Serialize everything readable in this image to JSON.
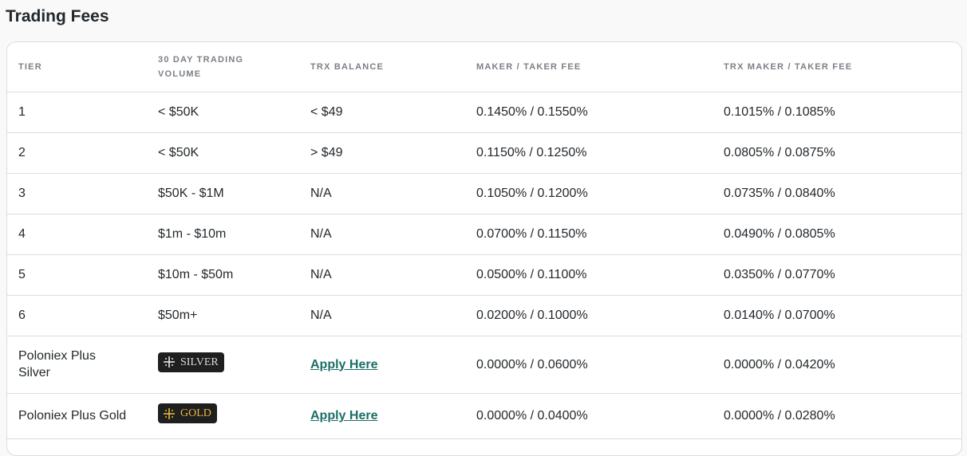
{
  "page": {
    "title": "Trading Fees"
  },
  "table": {
    "headers": [
      "TIER",
      "30 DAY TRADING VOLUME",
      "TRX BALANCE",
      "MAKER / TAKER FEE",
      "TRX MAKER / TAKER FEE"
    ],
    "rows": [
      {
        "tier": "1",
        "volume": "< $50K",
        "trx_balance": "< $49",
        "maker_taker": "0.1450% / 0.1550%",
        "trx_maker_taker": "0.1015% / 0.1085%"
      },
      {
        "tier": "2",
        "volume": "< $50K",
        "trx_balance": "> $49",
        "maker_taker": "0.1150% / 0.1250%",
        "trx_maker_taker": "0.0805% / 0.0875%"
      },
      {
        "tier": "3",
        "volume": "$50K - $1M",
        "trx_balance": "N/A",
        "maker_taker": "0.1050% / 0.1200%",
        "trx_maker_taker": "0.0735% / 0.0840%"
      },
      {
        "tier": "4",
        "volume": "$1m - $10m",
        "trx_balance": "N/A",
        "maker_taker": "0.0700% / 0.1150%",
        "trx_maker_taker": "0.0490% / 0.0805%"
      },
      {
        "tier": "5",
        "volume": "$10m - $50m",
        "trx_balance": "N/A",
        "maker_taker": "0.0500% / 0.1100%",
        "trx_maker_taker": "0.0350% / 0.0770%"
      },
      {
        "tier": "6",
        "volume": "$50m+",
        "trx_balance": "N/A",
        "maker_taker": "0.0200% / 0.1000%",
        "trx_maker_taker": "0.0140% / 0.0700%"
      },
      {
        "tier": "Poloniex Plus Silver",
        "badge": "SILVER",
        "trx_balance_link": "Apply Here",
        "maker_taker": "0.0000% / 0.0600%",
        "trx_maker_taker": "0.0000% / 0.0420%"
      },
      {
        "tier": "Poloniex Plus Gold",
        "badge": "GOLD",
        "trx_balance_link": "Apply Here",
        "maker_taker": "0.0000% / 0.0400%",
        "trx_maker_taker": "0.0000% / 0.0280%"
      }
    ]
  },
  "icons": {
    "badge_icon": "sparkle-icon"
  },
  "colors": {
    "link": "#1b6f66",
    "gold_badge_text": "#e7b63b",
    "silver_badge_text": "#d9d9d9",
    "badge_bg": "#1f1f1f"
  }
}
